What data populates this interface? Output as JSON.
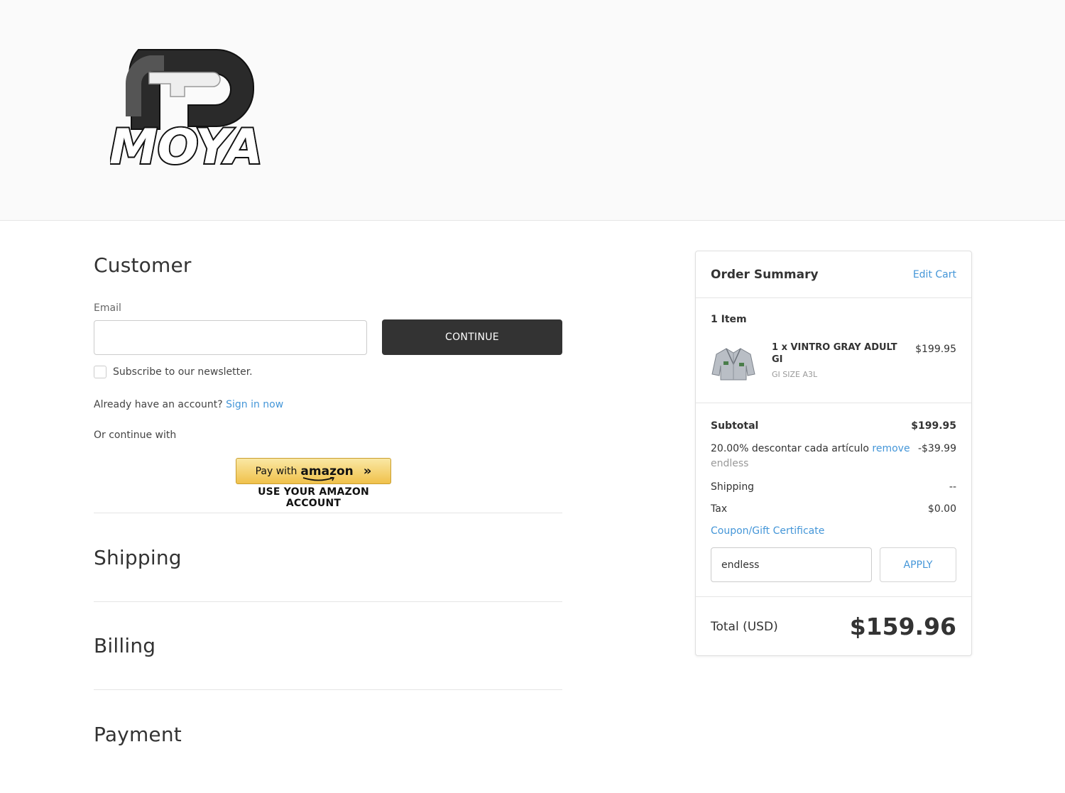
{
  "brand": {
    "logo_text": "MOYA"
  },
  "customer": {
    "title": "Customer",
    "email_label": "Email",
    "email_value": "",
    "continue_label": "CONTINUE",
    "newsletter_label": "Subscribe to our newsletter.",
    "account_prompt": "Already have an account?",
    "signin_label": "Sign in now",
    "or_continue": "Or continue with",
    "amazon": {
      "pay_with": "Pay with",
      "brand": "amazon",
      "caption": "USE YOUR AMAZON ACCOUNT"
    }
  },
  "sections": {
    "shipping": "Shipping",
    "billing": "Billing",
    "payment": "Payment"
  },
  "summary": {
    "title": "Order Summary",
    "edit_cart": "Edit Cart",
    "item_count": "1 Item",
    "item": {
      "name": "1 x VINTRO GRAY ADULT GI",
      "option": "GI SIZE A3L",
      "price": "$199.95"
    },
    "subtotal_label": "Subtotal",
    "subtotal_value": "$199.95",
    "discount_label": "20.00% descontar cada artículo",
    "discount_remove": "remove",
    "discount_code": "endless",
    "discount_value": "-$39.99",
    "shipping_label": "Shipping",
    "shipping_value": "--",
    "tax_label": "Tax",
    "tax_value": "$0.00",
    "coupon_link": "Coupon/Gift Certificate",
    "coupon_value": "endless",
    "apply_label": "APPLY",
    "total_label": "Total (USD)",
    "total_value": "$159.96"
  },
  "colors": {
    "link": "#4496d8",
    "dark_button": "#333333",
    "amazon_gold": "#f0c14b"
  }
}
